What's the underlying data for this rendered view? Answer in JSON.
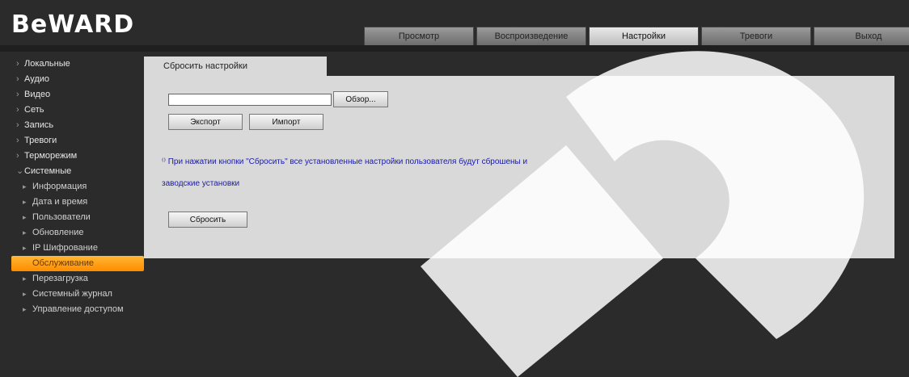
{
  "brand": {
    "logo_text": "BeWARD"
  },
  "nav": {
    "tabs": [
      {
        "label": "Просмотр"
      },
      {
        "label": "Воспроизведение"
      },
      {
        "label": "Настройки",
        "active": true
      },
      {
        "label": "Тревоги"
      },
      {
        "label": "Выход"
      }
    ]
  },
  "sidebar": {
    "items": [
      {
        "label": "Локальные"
      },
      {
        "label": "Аудио"
      },
      {
        "label": "Видео"
      },
      {
        "label": "Сеть"
      },
      {
        "label": "Запись"
      },
      {
        "label": "Тревоги"
      },
      {
        "label": "Терморежим"
      },
      {
        "label": "Системные",
        "open": true
      }
    ],
    "subitems": [
      {
        "label": "Информация"
      },
      {
        "label": "Дата и время"
      },
      {
        "label": "Пользователи"
      },
      {
        "label": "Обновление"
      },
      {
        "label": "IP Шифрование"
      },
      {
        "label": "Обслуживание",
        "active": true
      },
      {
        "label": "Перезагрузка"
      },
      {
        "label": "Системный журнал"
      },
      {
        "label": "Управление доступом"
      }
    ]
  },
  "content": {
    "tab_label": "Сбросить настройки",
    "file_input_value": "",
    "browse_label": "Обзор...",
    "import_label": "Экспорт",
    "export_label": "Импорт",
    "note_line1": "При нажатии кнопки \"Сбросить\" все установленные настройки пользователя будут сброшены и",
    "note_line2": "заводские установки",
    "reset_label": "Сбросить"
  }
}
